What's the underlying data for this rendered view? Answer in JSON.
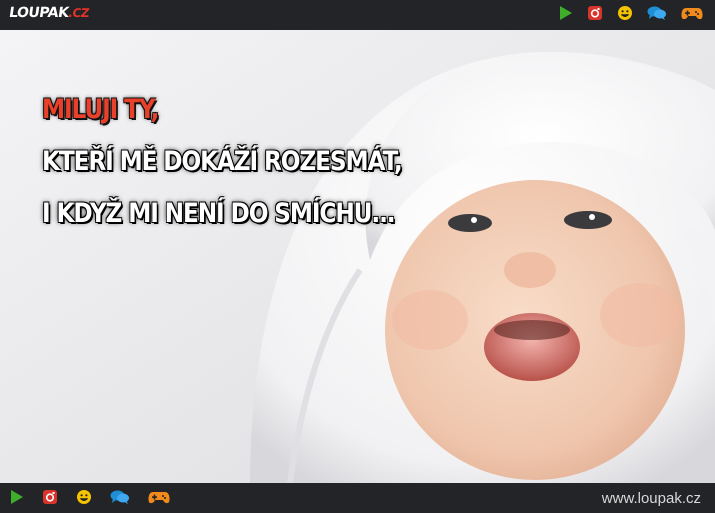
{
  "header": {
    "logo_main": "LOUPAK",
    "logo_suffix": ".CZ",
    "icons": [
      "play-icon",
      "instagram-icon",
      "smiley-icon",
      "chat-icon",
      "gamepad-icon"
    ]
  },
  "meme": {
    "line1": "MILUJI TY,",
    "line2": "KTEŘÍ MĚ DOKÁŽÍ ROZESMÁT,",
    "line3": "I KDYŽ MI NENÍ DO SMÍCHU..."
  },
  "footer": {
    "icons": [
      "play-icon",
      "instagram-icon",
      "smiley-icon",
      "chat-icon",
      "gamepad-icon"
    ],
    "site_url": "www.loupak.cz"
  },
  "colors": {
    "bar": "#232428",
    "accent_red": "#e8402b",
    "play_green": "#3fae2a",
    "instagram_red": "#d9342b",
    "smiley_yellow": "#f5c400",
    "chat_blue": "#1e8fd6",
    "gamepad_orange": "#f08a1c"
  }
}
